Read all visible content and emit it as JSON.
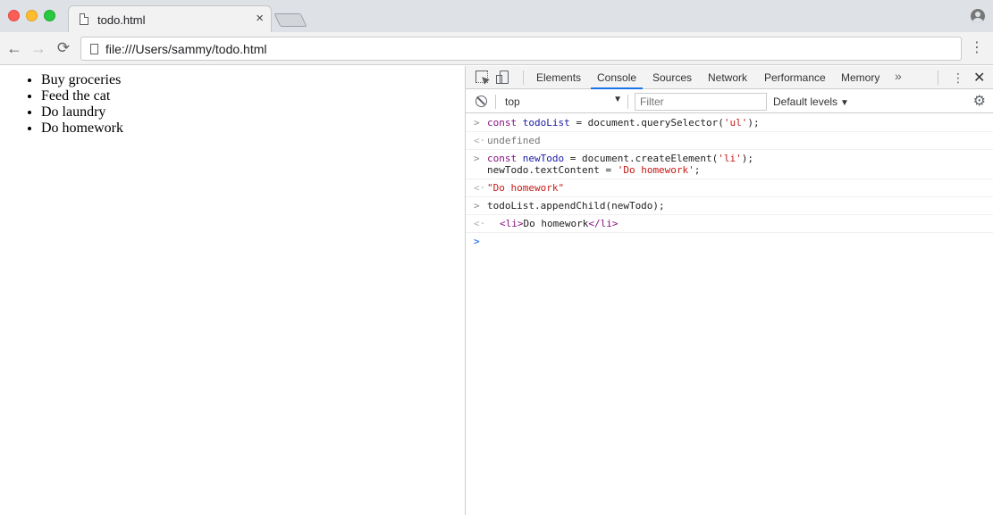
{
  "browser": {
    "tab_title": "todo.html",
    "tab_close": "×",
    "url": "file:///Users/sammy/todo.html",
    "nav": {
      "back": "←",
      "forward": "→",
      "reload": "⟳"
    },
    "menu": "⋮"
  },
  "page": {
    "todos": [
      "Buy groceries",
      "Feed the cat",
      "Do laundry",
      "Do homework"
    ]
  },
  "devtools": {
    "tabs": [
      "Elements",
      "Console",
      "Sources",
      "Network",
      "Performance",
      "Memory"
    ],
    "active_tab": "Console",
    "more": "»",
    "menu": "⋮",
    "close": "✕",
    "context": "top",
    "context_arrow": "▼",
    "filter_placeholder": "Filter",
    "levels": "Default levels",
    "levels_arrow": "▼",
    "settings": "⚙",
    "console": {
      "entry1_const": "const",
      "entry1_var": "todoList",
      "entry1_mid": " = document.querySelector(",
      "entry1_str": "'ul'",
      "entry1_end": ");",
      "result1": "undefined",
      "entry2_const": "const",
      "entry2_var": "newTodo",
      "entry2_mid": " = document.createElement(",
      "entry2_str": "'li'",
      "entry2_end": ");",
      "entry2_line2_pre": "newTodo.textContent = ",
      "entry2_line2_str": "'Do homework'",
      "entry2_line2_end": ";",
      "result2": "\"Do homework\"",
      "entry3": "todoList.appendChild(newTodo);",
      "result3_open": "<li>",
      "result3_text": "Do homework",
      "result3_close": "</li>",
      "prompt_in": ">",
      "prompt_out": "<·",
      "caret": ">"
    },
    "colors": {
      "accent": "#1a73e8",
      "string": "#c41a16",
      "keyword": "#881280",
      "variable": "#1a1aa6"
    }
  }
}
